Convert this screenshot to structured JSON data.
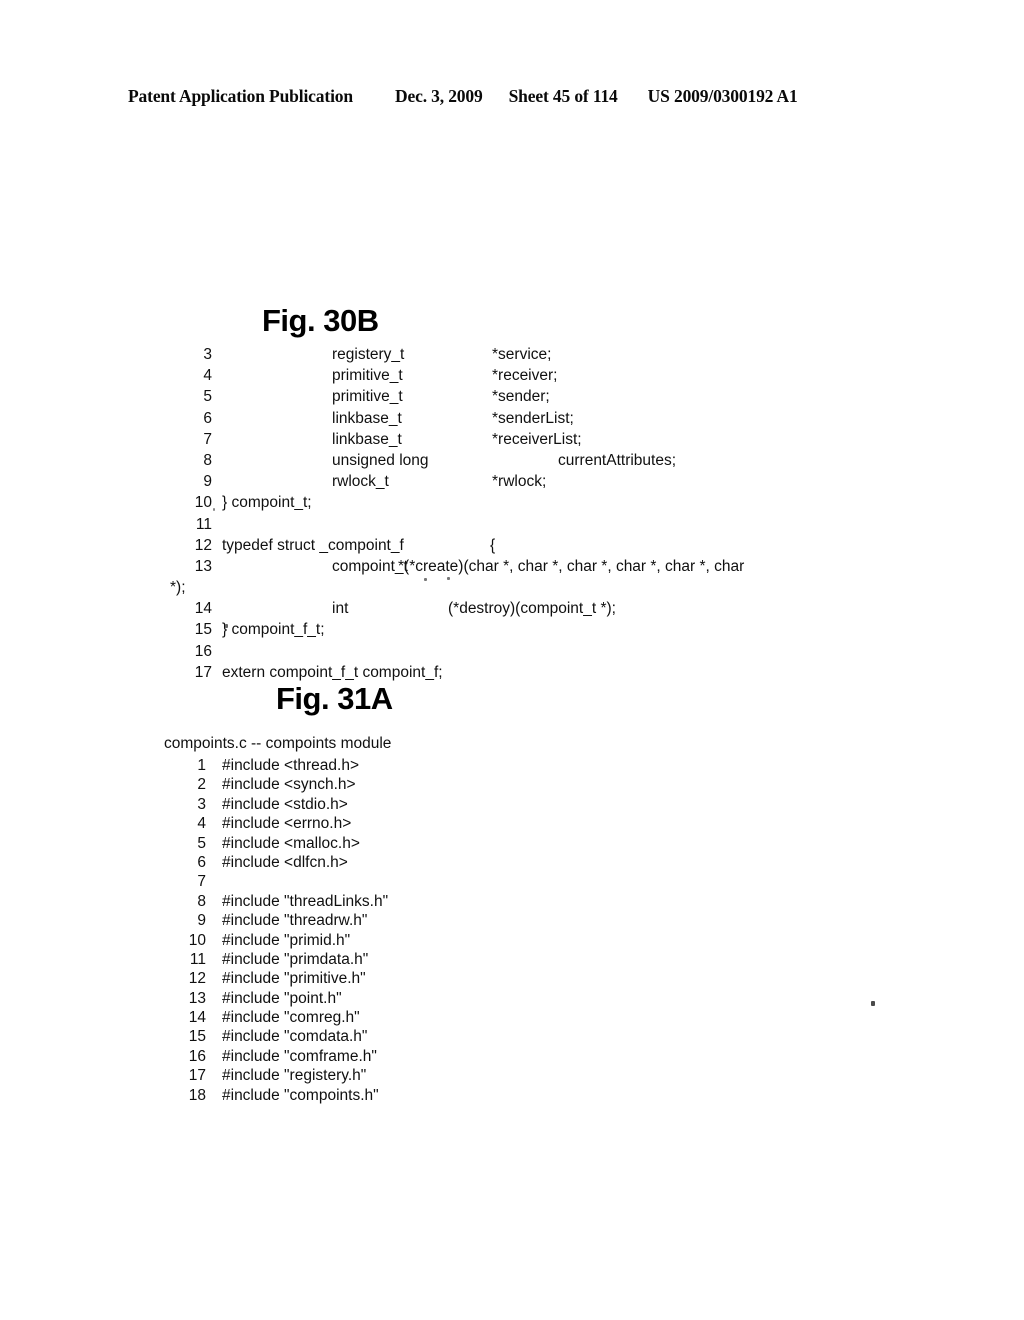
{
  "page_header": {
    "publication": "Patent Application Publication",
    "date": "Dec. 3, 2009",
    "sheet": "Sheet 45 of 114",
    "patent_number": "US 2009/0300192 A1"
  },
  "figures": [
    {
      "id": "fig-30b",
      "heading": "Fig. 30B",
      "caption": "",
      "lines": [
        {
          "no": "3",
          "layout": "decl",
          "type": "registery_t",
          "name": "*service;"
        },
        {
          "no": "4",
          "layout": "decl",
          "type": "primitive_t",
          "name": "*receiver;"
        },
        {
          "no": "5",
          "layout": "decl",
          "type": "primitive_t",
          "name": "*sender;"
        },
        {
          "no": "6",
          "layout": "decl",
          "type": "linkbase_t",
          "name": "*senderList;"
        },
        {
          "no": "7",
          "layout": "decl",
          "type": "linkbase_t",
          "name": "*receiverList;"
        },
        {
          "no": "8",
          "layout": "decl-deep",
          "type": "unsigned long",
          "name": "currentAttributes;"
        },
        {
          "no": "9",
          "layout": "decl",
          "type": "rwlock_t",
          "name": "*rwlock;"
        },
        {
          "no": "10",
          "layout": "stmt",
          "text": "} compoint_t;"
        },
        {
          "no": "11",
          "layout": "blank",
          "text": ""
        },
        {
          "no": "12",
          "layout": "typedef",
          "text": "typedef struct _compoint_f",
          "brace": "{"
        },
        {
          "no": "13",
          "layout": "proto",
          "type": "compoint_t",
          "text": "*(*create)(char *, char *, char *, char *, char *, char",
          "wrap": "*);"
        },
        {
          "no": "14",
          "layout": "proto2",
          "type": "int",
          "text": "(*destroy)(compoint_t *);"
        },
        {
          "no": "15",
          "layout": "stmt",
          "text": "} compoint_f_t;"
        },
        {
          "no": "16",
          "layout": "blank",
          "text": ""
        },
        {
          "no": "17",
          "layout": "stmt",
          "text": "extern compoint_f_t compoint_f;"
        }
      ]
    },
    {
      "id": "fig-31a",
      "heading": "Fig. 31A",
      "caption": "compoints.c -- compoints module",
      "lines": [
        {
          "no": "1",
          "text": "#include <thread.h>"
        },
        {
          "no": "2",
          "text": "#include <synch.h>"
        },
        {
          "no": "3",
          "text": "#include <stdio.h>"
        },
        {
          "no": "4",
          "text": "#include <errno.h>"
        },
        {
          "no": "5",
          "text": "#include <malloc.h>"
        },
        {
          "no": "6",
          "text": "#include <dlfcn.h>"
        },
        {
          "no": "7",
          "text": ""
        },
        {
          "no": "8",
          "text": "#include \"threadLinks.h\""
        },
        {
          "no": "9",
          "text": "#include \"threadrw.h\""
        },
        {
          "no": "10",
          "text": "#include \"primid.h\""
        },
        {
          "no": "11",
          "text": "#include \"primdata.h\""
        },
        {
          "no": "12",
          "text": "#include \"primitive.h\""
        },
        {
          "no": "13",
          "text": "#include \"point.h\""
        },
        {
          "no": "14",
          "text": "#include \"comreg.h\""
        },
        {
          "no": "15",
          "text": "#include \"comdata.h\""
        },
        {
          "no": "16",
          "text": "#include \"comframe.h\""
        },
        {
          "no": "17",
          "text": "#include \"registery.h\""
        },
        {
          "no": "18",
          "text": "#include \"compoints.h\""
        }
      ]
    }
  ]
}
